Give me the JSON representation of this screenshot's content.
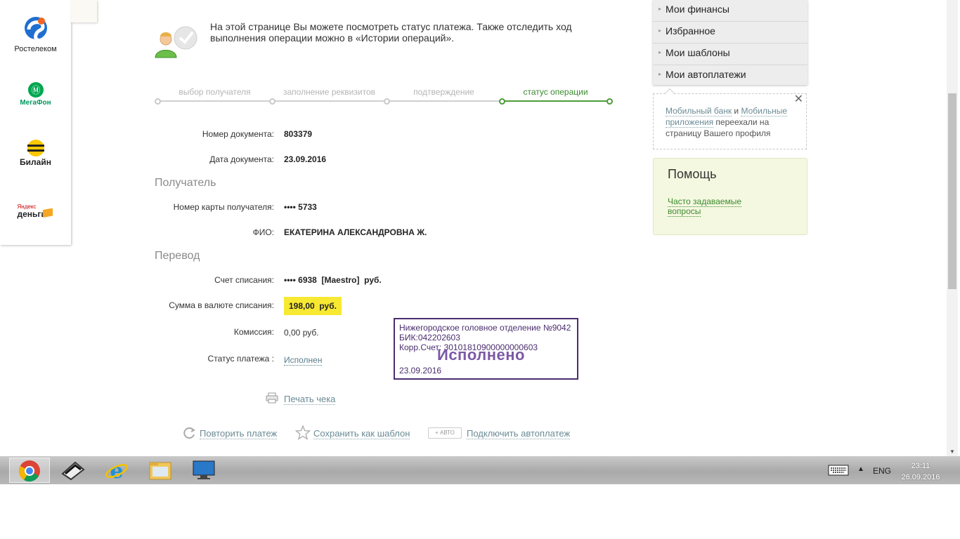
{
  "partners": [
    {
      "name": "Ростелеком"
    },
    {
      "name": "МегаФон"
    },
    {
      "name": "Билайн"
    },
    {
      "name_top": "Яндекс",
      "name_bottom": "деньги"
    }
  ],
  "intro": {
    "text": "На этой странице Вы можете посмотреть статус платежа. Также отследить ход выполнения операции можно в «Истории операций»."
  },
  "steps": [
    {
      "label": "выбор получателя"
    },
    {
      "label": "заполнение реквизитов"
    },
    {
      "label": "подтверждение"
    },
    {
      "label": "статус операции"
    }
  ],
  "document": {
    "number_label": "Номер документа:",
    "number_value": "803379",
    "date_label": "Дата документа:",
    "date_value": "23.09.2016"
  },
  "recipient": {
    "section_title": "Получатель",
    "card_label": "Номер карты получателя:",
    "card_value": "•••• 5733",
    "name_label": "ФИО:",
    "name_value": "ЕКАТЕРИНА АЛЕКСАНДРОВНА Ж."
  },
  "transfer": {
    "section_title": "Перевод",
    "account_label": "Счет списания:",
    "account_value": "•••• 6938  [Maestro]  руб.",
    "amount_label": "Сумма в валюте списания:",
    "amount_value": "198,00  руб.",
    "fee_label": "Комиссия:",
    "fee_value": "0,00 руб.",
    "status_label": "Статус платежа :",
    "status_value": "Исполнен"
  },
  "stamp": {
    "line1": "Нижегородское головное отделение №9042",
    "line2": "БИК:042202603",
    "line3": "Корр.Счет: 30101810900000000603",
    "status": "Исполнено",
    "date": "23.09.2016"
  },
  "actions": {
    "print": "Печать чека",
    "repeat": "Повторить платеж",
    "save_template": "Сохранить как шаблон",
    "auto_badge": "+ АВТО",
    "autopay": "Подключить автоплатеж"
  },
  "right_menu": [
    {
      "label": "Мои финансы"
    },
    {
      "label": "Избранное"
    },
    {
      "label": "Мои шаблоны"
    },
    {
      "label": "Мои автоплатежи"
    }
  ],
  "notice": {
    "link1": "Мобильный банк",
    "conj": " и ",
    "link2": "Мобильные приложения",
    "rest": " переехали на страницу Вашего профиля",
    "close": "✕"
  },
  "help": {
    "title": "Помощь",
    "faq": "Часто задаваемые вопросы"
  },
  "taskbar": {
    "lang": "ENG",
    "time": "23:11",
    "date": "26.09.2016"
  },
  "colors": {
    "accent_green": "#4d9b3a",
    "highlight_yellow": "#f7e832",
    "stamp_purple": "#4a2d6e"
  }
}
